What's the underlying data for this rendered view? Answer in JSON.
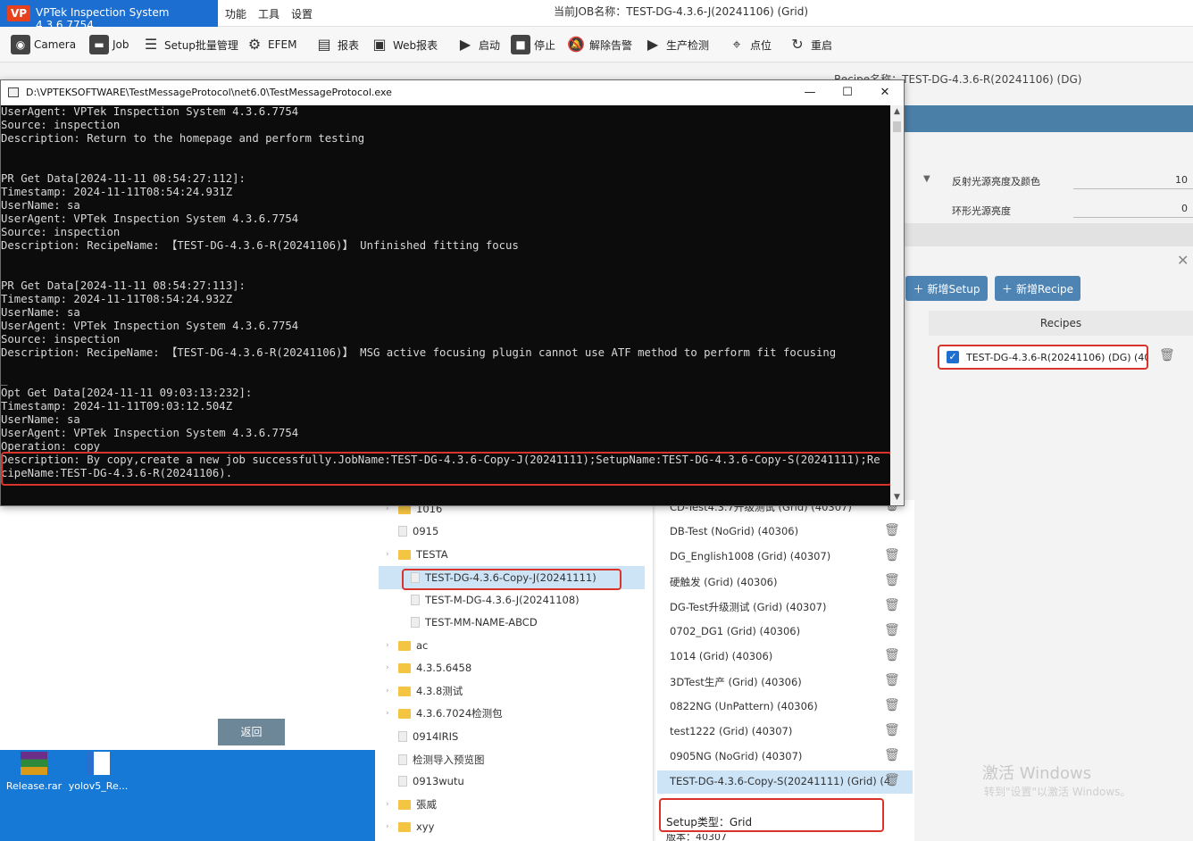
{
  "app": {
    "brand": "VPTek Inspection System 4.3.6.7754",
    "menus": [
      "功能",
      "工具",
      "设置"
    ],
    "job_title": "当前JOB名称：TEST-DG-4.3.6-J(20241106) (Grid)"
  },
  "toolbar": {
    "camera": "Camera",
    "job": "Job",
    "setup_batch": "Setup批量管理",
    "efem": "EFEM",
    "report": "报表",
    "web_report": "Web报表",
    "start": "启动",
    "stop": "停止",
    "release_alarm": "解除告警",
    "production_check": "生产检测",
    "point": "点位",
    "restart": "重启"
  },
  "right_panel": {
    "recipe_name": "Recipe名称：TEST-DG-4.3.6-R(20241106) (DG)",
    "param1_label": "反射光源亮度及颜色",
    "param1_value": "10",
    "param2_label": "环形光源亮度",
    "param2_value": "0",
    "add_setup": "新增Setup",
    "add_recipe": "新增Recipe",
    "recipes_header": "Recipes",
    "recipe_item": "TEST-DG-4.3.6-R(20241106) (DG) (40:",
    "watermark_1": "激活 Windows",
    "watermark_2": "转到\"设置\"以激活 Windows。"
  },
  "console": {
    "title": "D:\\VPTEKSOFTWARE\\TestMessageProtocol\\net6.0\\TestMessageProtocol.exe",
    "text": "UserAgent: VPTek Inspection System 4.3.6.7754\nSource: inspection\nDescription: Return to the homepage and perform testing\n\n\nPR Get Data[2024-11-11 08:54:27:112]:\nTimestamp: 2024-11-11T08:54:24.931Z\nUserName: sa\nUserAgent: VPTek Inspection System 4.3.6.7754\nSource: inspection\nDescription: RecipeName: 【TEST-DG-4.3.6-R(20241106)】 Unfinished fitting focus\n\n\nPR Get Data[2024-11-11 08:54:27:113]:\nTimestamp: 2024-11-11T08:54:24.932Z\nUserName: sa\nUserAgent: VPTek Inspection System 4.3.6.7754\nSource: inspection\nDescription: RecipeName: 【TEST-DG-4.3.6-R(20241106)】 MSG active focusing plugin cannot use ATF method to perform fit focusing\n\n_\nOpt Get Data[2024-11-11 09:03:13:232]:\nTimestamp: 2024-11-11T09:03:12.504Z\nUserName: sa\nUserAgent: VPTek Inspection System 4.3.6.7754\nOperation: copy\nDescription: By copy,create a new job successfully.JobName:TEST-DG-4.3.6-Copy-J(20241111);SetupName:TEST-DG-4.3.6-Copy-S(20241111);Re\ncipeName:TEST-DG-4.3.6-R(20241106)."
  },
  "tree": {
    "items": [
      {
        "label": "1016",
        "kind": "folder"
      },
      {
        "label": "0915",
        "kind": "doc"
      },
      {
        "label": "TESTA",
        "kind": "folder"
      },
      {
        "label": "TEST-DG-4.3.6-Copy-J(20241111)",
        "kind": "doc"
      },
      {
        "label": "TEST-M-DG-4.3.6-J(20241108)",
        "kind": "doc"
      },
      {
        "label": "TEST-MM-NAME-ABCD",
        "kind": "doc"
      },
      {
        "label": "ac",
        "kind": "folder"
      },
      {
        "label": "4.3.5.6458",
        "kind": "folder"
      },
      {
        "label": "4.3.8测试",
        "kind": "folder"
      },
      {
        "label": "4.3.6.7024检测包",
        "kind": "folder"
      },
      {
        "label": "0914IRIS",
        "kind": "doc"
      },
      {
        "label": "检测导入预览图",
        "kind": "doc"
      },
      {
        "label": "0913wutu",
        "kind": "doc"
      },
      {
        "label": "張威",
        "kind": "folder"
      },
      {
        "label": "xyy",
        "kind": "folder"
      }
    ]
  },
  "setups": {
    "items": [
      "CD-Test4.3.7升级测试 (Grid) (40307)",
      "DB-Test (NoGrid) (40306)",
      "DG_English1008 (Grid) (40307)",
      "硬触发 (Grid) (40306)",
      "DG-Test升级测试 (Grid) (40307)",
      "0702_DG1 (Grid) (40306)",
      "1014 (Grid) (40306)",
      "3DTest生产 (Grid) (40306)",
      "0822NG (UnPattern) (40306)",
      "test1222 (Grid) (40307)",
      "0905NG (NoGrid) (40307)",
      "TEST-DG-4.3.6-Copy-S(20241111) (Grid) (4"
    ],
    "setup_type": "Setup类型：Grid",
    "version_partial": "版本：40307"
  },
  "left": {
    "back_button": "返回",
    "desktop_icons": [
      "Release.rar",
      "yolov5_Re..."
    ]
  }
}
